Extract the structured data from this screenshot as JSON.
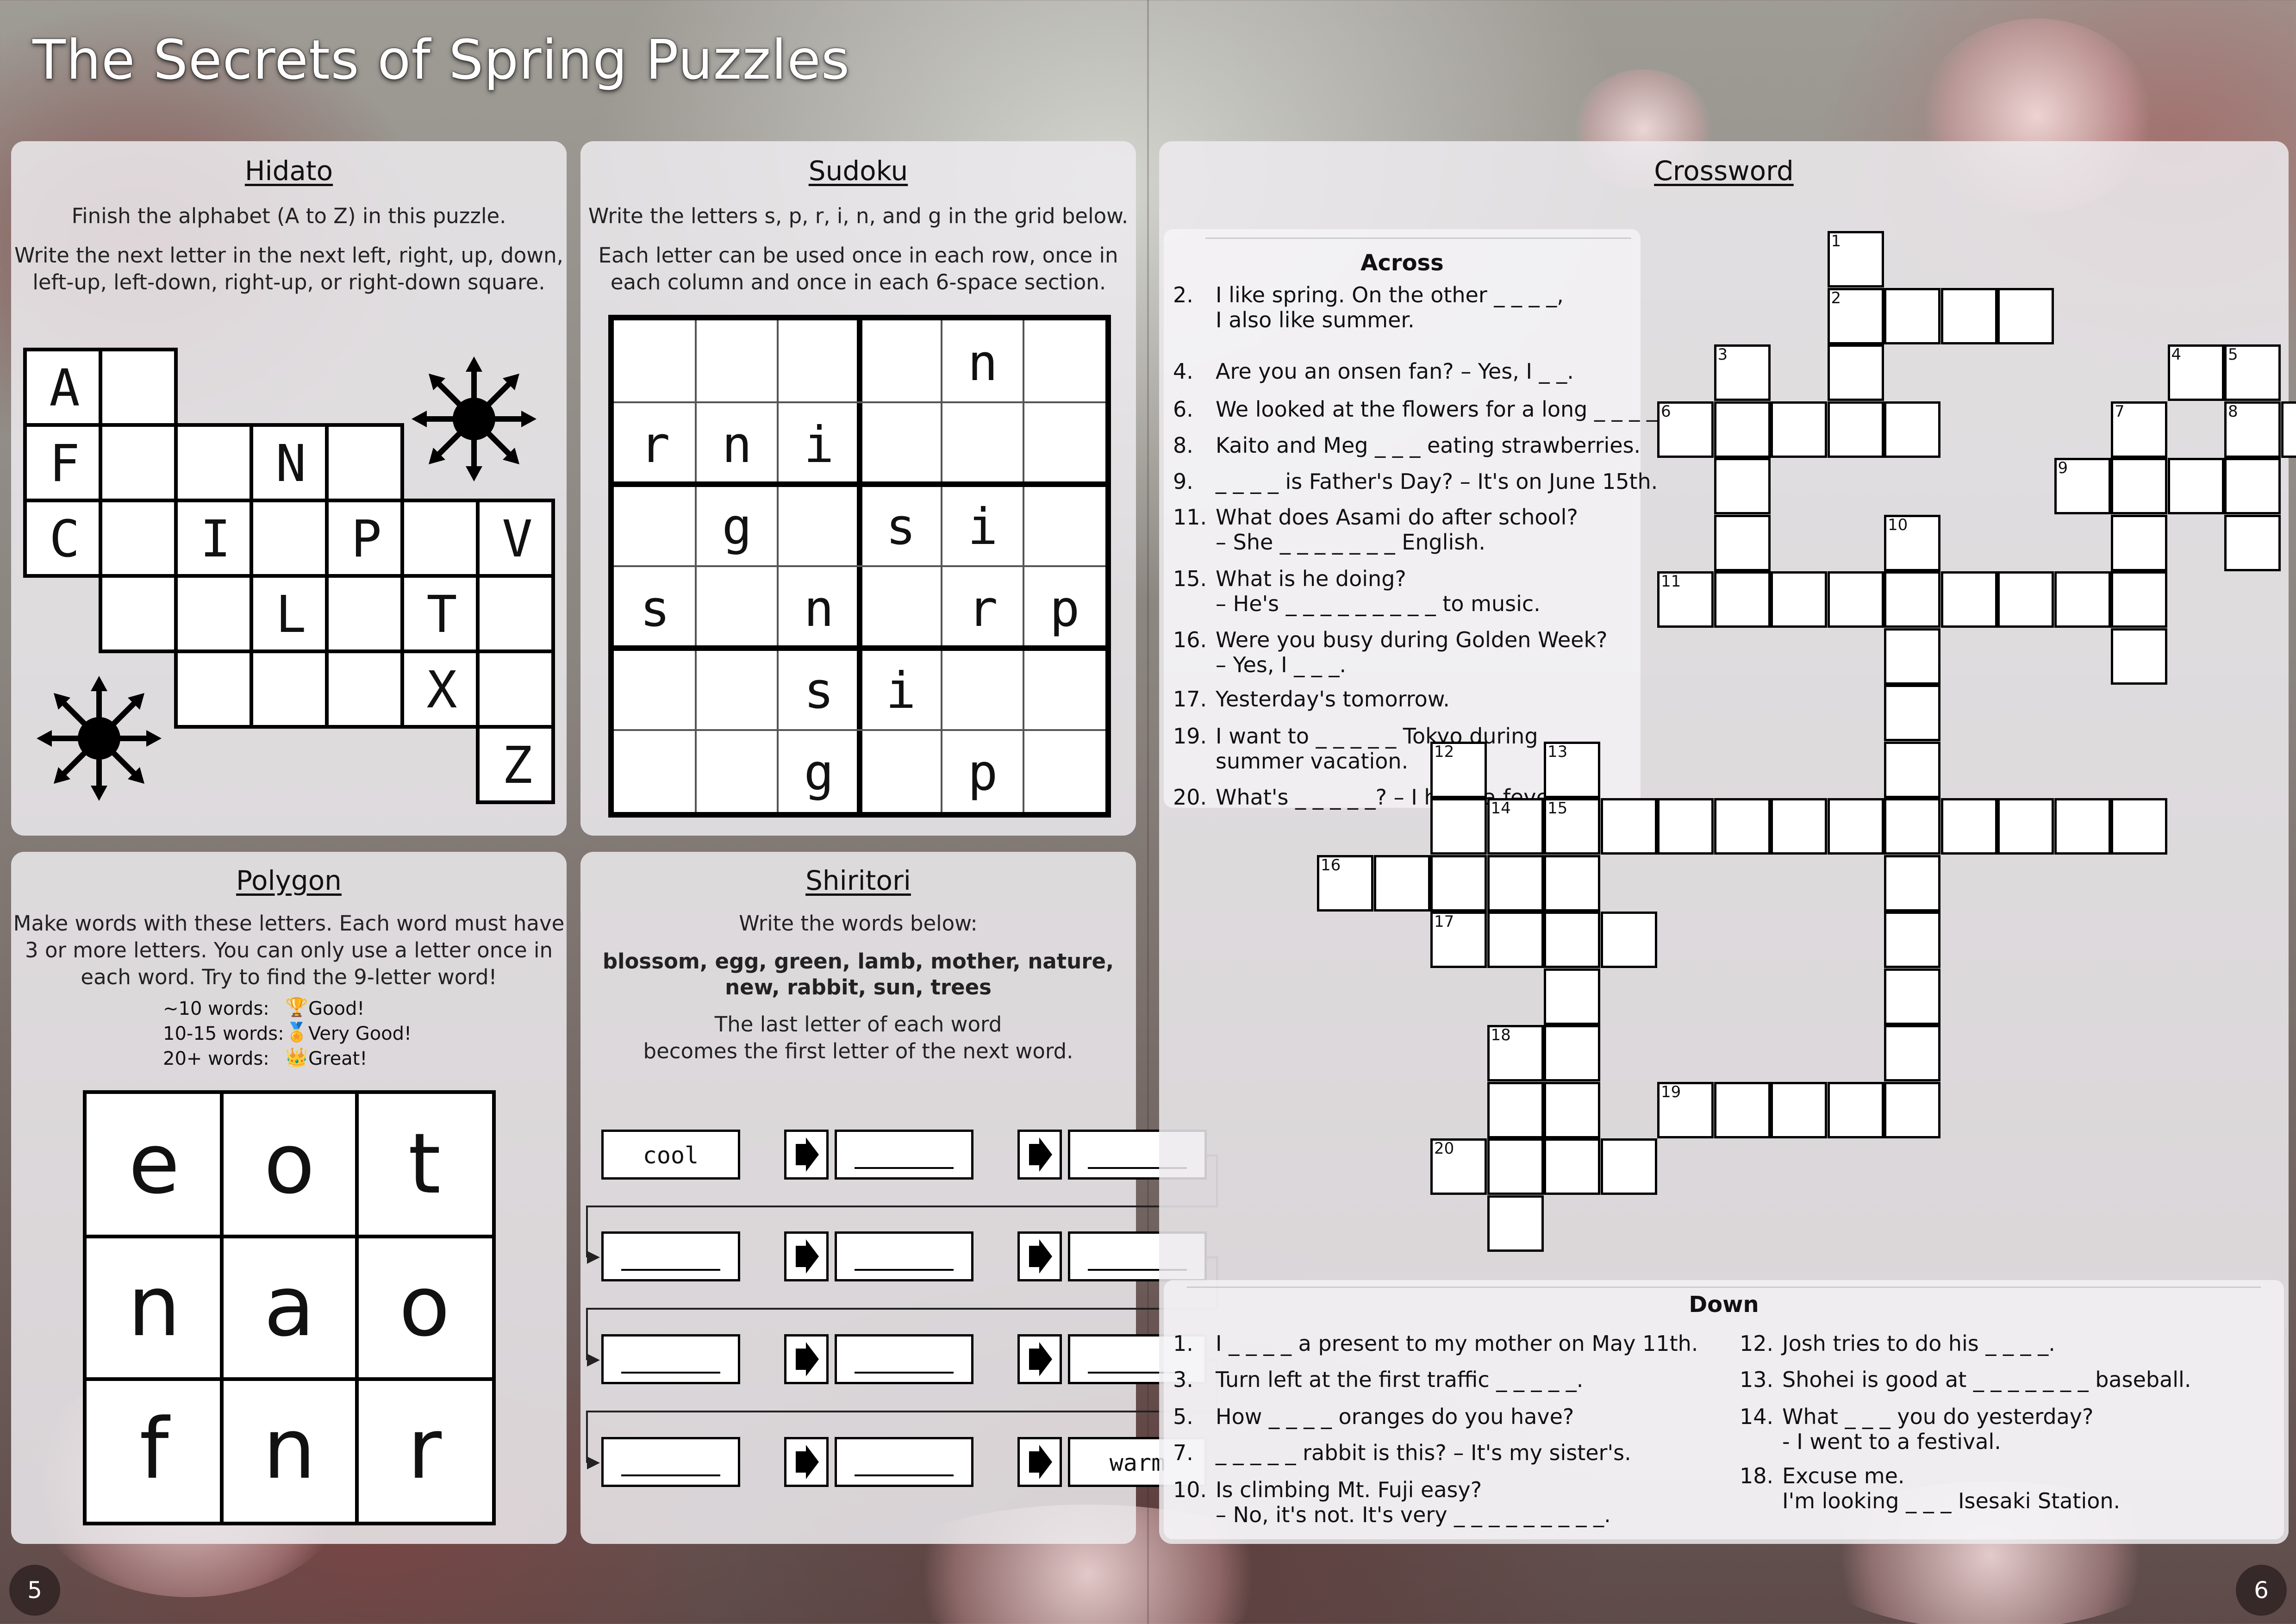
{
  "book_title": "The Secrets of Spring Puzzles",
  "page_numbers": {
    "left": "5",
    "right": "6"
  },
  "hidato": {
    "title": "Hidato",
    "line1": "Finish the alphabet (A to Z) in this puzzle.",
    "line2": "Write the next letter in the next left, right, up, down,",
    "line3": "left-up, left-down, right-up, or right-down square.",
    "letters": {
      "a": "A",
      "f": "F",
      "n": "N",
      "c": "C",
      "i": "I",
      "p": "P",
      "v": "V",
      "l": "L",
      "t": "T",
      "x": "X",
      "z": "Z"
    }
  },
  "sudoku": {
    "title": "Sudoku",
    "line1": "Write the letters s, p, r, i, n, and g in the grid below.",
    "line2": "Each letter can be used once in each row, once in",
    "line3": "each column and once in each 6-space section.",
    "grid": [
      [
        "",
        "",
        "",
        "",
        "n",
        ""
      ],
      [
        "r",
        "n",
        "i",
        "",
        "",
        ""
      ],
      [
        "",
        "g",
        "",
        "s",
        "i",
        ""
      ],
      [
        "s",
        "",
        "n",
        "",
        "r",
        "p"
      ],
      [
        "",
        "",
        "s",
        "i",
        "",
        ""
      ],
      [
        "",
        "",
        "g",
        "",
        "p",
        ""
      ]
    ]
  },
  "polygon": {
    "title": "Polygon",
    "line1": "Make words with these letters. Each word must have",
    "line2": "3 or more letters. You can only use a letter once in",
    "line3": "each word. Try to find the 9-letter word!",
    "ratings": [
      {
        "range": "~10 words:",
        "label": "Good!"
      },
      {
        "range": "10-15 words:",
        "label": "Very Good!"
      },
      {
        "range": "20+ words:",
        "label": "Great!"
      }
    ],
    "grid": [
      [
        "e",
        "o",
        "t"
      ],
      [
        "n",
        "a",
        "o"
      ],
      [
        "f",
        "n",
        "r"
      ]
    ]
  },
  "shiritori": {
    "title": "Shiritori",
    "line1": "Write the words below:",
    "words1": "blossom, egg, green, lamb, mother, nature,",
    "words2": "new, rabbit, sun, trees",
    "line3": "The last letter of each word",
    "line4": "becomes the first letter of the next word.",
    "start_word": "cool",
    "end_word": "warm"
  },
  "crossword": {
    "title": "Crossword",
    "across_heading": "Across",
    "down_heading": "Down",
    "across": [
      {
        "num": "2.",
        "l1": "I like spring. On the other _ _ _ _,",
        "l2": "I also like summer."
      },
      {
        "num": "4.",
        "l1": "Are you an onsen fan? – Yes, I _ _.",
        "l2": ""
      },
      {
        "num": "6.",
        "l1": "We looked at the flowers for a long _ _ _ _.",
        "l2": ""
      },
      {
        "num": "8.",
        "l1": "Kaito and Meg _ _ _ eating strawberries.",
        "l2": ""
      },
      {
        "num": "9.",
        "l1": "_ _ _ _ is Father's Day? – It's on June 15th.",
        "l2": ""
      },
      {
        "num": "11.",
        "l1": "What does Asami do after school?",
        "l2": "– She _ _ _ _ _ _ _ English."
      },
      {
        "num": "15.",
        "l1": "What is he doing?",
        "l2": "– He's _ _ _ _ _ _ _ _ _ to music."
      },
      {
        "num": "16.",
        "l1": "Were you busy during Golden Week?",
        "l2": "– Yes, I _ _ _."
      },
      {
        "num": "17.",
        "l1": "Yesterday's tomorrow.",
        "l2": ""
      },
      {
        "num": "19.",
        "l1": "I want to _ _ _ _ _ Tokyo during",
        "l2": "summer vacation."
      },
      {
        "num": "20.",
        "l1": "What's _ _ _ _ _? – I have a fever.",
        "l2": ""
      }
    ],
    "down_left": [
      {
        "num": "1.",
        "l1": "I _ _ _ _ a present to my mother on May 11th.",
        "l2": ""
      },
      {
        "num": "3.",
        "l1": "Turn left at the first traffic _ _ _ _ _.",
        "l2": ""
      },
      {
        "num": "5.",
        "l1": "How _ _ _ _ oranges do you have?",
        "l2": ""
      },
      {
        "num": "7.",
        "l1": "_ _ _ _ _ rabbit is this? – It's my sister's.",
        "l2": ""
      },
      {
        "num": "10.",
        "l1": "Is climbing Mt. Fuji easy?",
        "l2": "– No, it's not. It's very   _ _ _ _ _ _ _ _ _."
      }
    ],
    "down_right": [
      {
        "num": "12.",
        "l1": "Josh tries to do his _ _ _ _.",
        "l2": ""
      },
      {
        "num": "13.",
        "l1": "Shohei is good at _ _ _ _ _ _ _ baseball.",
        "l2": ""
      },
      {
        "num": "14.",
        "l1": "What _ _ _ you do yesterday?",
        "l2": "- I went to a festival."
      },
      {
        "num": "18.",
        "l1": "Excuse me.",
        "l2": "I'm looking _ _ _ Isesaki Station."
      }
    ],
    "numbers": [
      "1",
      "2",
      "3",
      "4",
      "5",
      "6",
      "7",
      "8",
      "9",
      "10",
      "11",
      "12",
      "13",
      "14",
      "15",
      "16",
      "17",
      "18",
      "19",
      "20"
    ]
  }
}
